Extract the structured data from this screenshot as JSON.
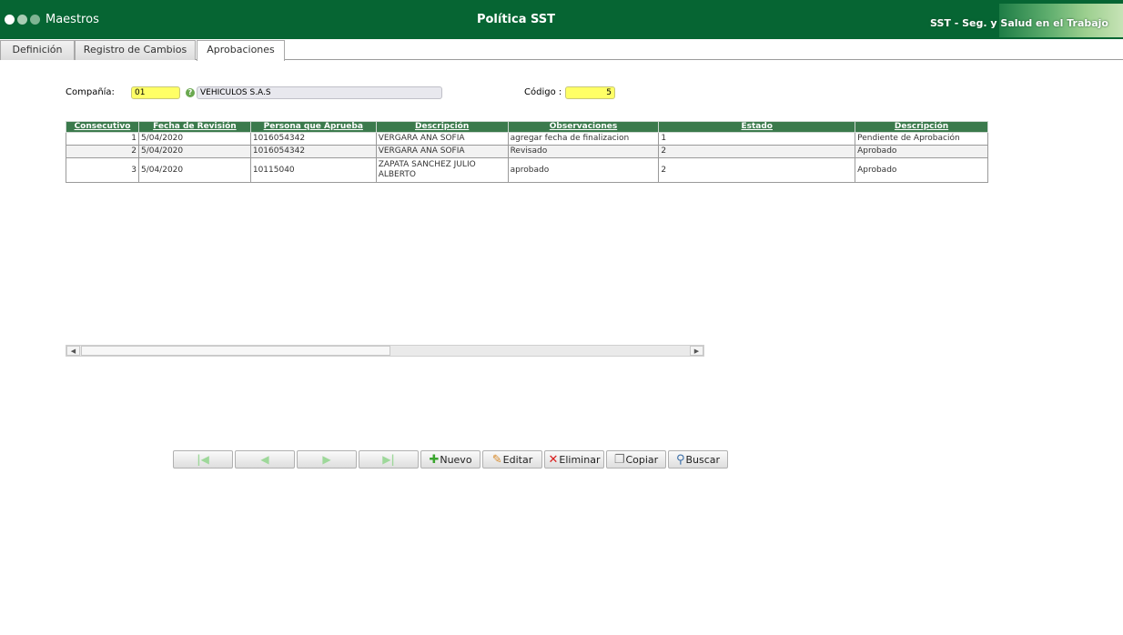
{
  "header": {
    "app_name": "Maestros",
    "title": "Política SST",
    "brand": "SST - Seg. y Salud en el Trabajo"
  },
  "tabs": [
    {
      "label": "Definición"
    },
    {
      "label": "Registro de Cambios"
    },
    {
      "label": "Aprobaciones",
      "active": true
    }
  ],
  "filters": {
    "company_label": "Compañía:",
    "company_code": "01",
    "company_name": "VEHICULOS S.A.S",
    "code_label": "Código :",
    "code_value": "5"
  },
  "grid": {
    "columns": [
      "Consecutivo",
      "Fecha de Revisión",
      "Persona que Aprueba",
      "Descripción",
      "Observaciones",
      "Estado",
      "Descripción"
    ],
    "rows": [
      [
        "1",
        "5/04/2020",
        "1016054342",
        "VERGARA ANA SOFIA",
        "agregar fecha de finalizacion",
        "1",
        "Pendiente de Aprobación"
      ],
      [
        "2",
        "5/04/2020",
        "1016054342",
        "VERGARA ANA SOFIA",
        "Revisado",
        "2",
        "Aprobado"
      ],
      [
        "3",
        "5/04/2020",
        "10115040",
        "ZAPATA SANCHEZ JULIO ALBERTO",
        "aprobado",
        "2",
        "Aprobado"
      ]
    ]
  },
  "toolbar": {
    "first": "first-record-icon",
    "prev": "previous-record-icon",
    "next": "next-record-icon",
    "last": "last-record-icon",
    "new_label": "Nuevo",
    "edit_label": "Editar",
    "delete_label": "Eliminar",
    "copy_label": "Copiar",
    "search_label": "Buscar"
  },
  "colors": {
    "header_bg": "#066533",
    "grid_header_bg": "#3b7a4c",
    "highlight_field": "#ffff66"
  }
}
